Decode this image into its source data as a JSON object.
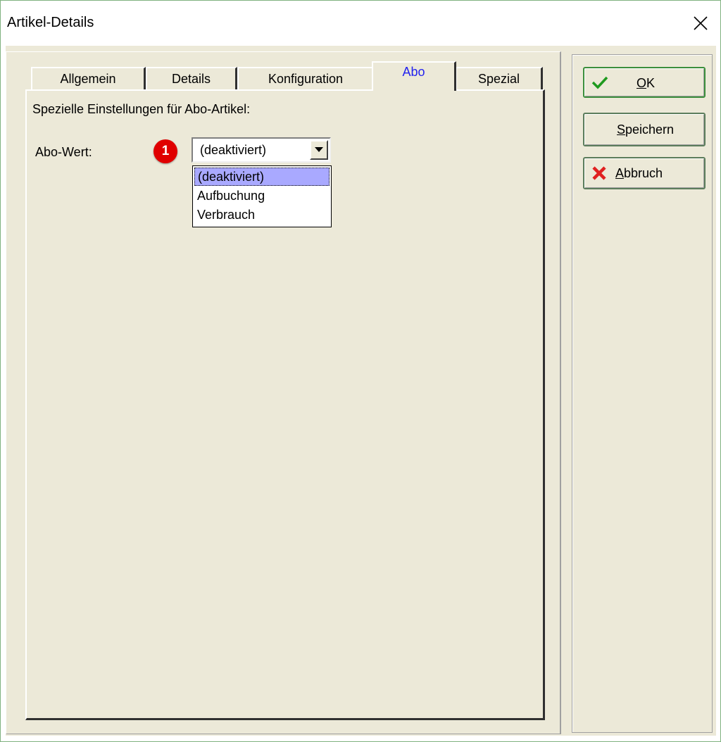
{
  "window": {
    "title": "Artikel-Details"
  },
  "tabs": [
    {
      "label": "Allgemein"
    },
    {
      "label": "Details"
    },
    {
      "label": "Konfiguration"
    },
    {
      "label": "Abo",
      "active": true
    },
    {
      "label": "Spezial"
    }
  ],
  "panel": {
    "heading": "Spezielle Einstellungen für Abo-Artikel:",
    "abo_label": "Abo-Wert:",
    "badge": "1",
    "combo_value": "(deaktiviert)",
    "options": [
      "(deaktiviert)",
      "Aufbuchung",
      "Verbrauch"
    ],
    "selected_option": "(deaktiviert)"
  },
  "buttons": {
    "ok_mnemonic": "O",
    "ok_rest": "K",
    "save_mnemonic": "S",
    "save_rest": "peichern",
    "cancel_mnemonic": "A",
    "cancel_rest": "bbruch"
  },
  "icons": {
    "close": "close-icon",
    "ok": "checkmark-icon",
    "cancel": "red-x-icon",
    "dropdown": "triangle-down-icon"
  },
  "colors": {
    "dialog_bg": "#ece9d8",
    "active_tab_text": "#2222ee",
    "selection": "#a9a9ff",
    "badge": "#e00000",
    "ok_check": "#1f9a1f",
    "cancel_x": "#e02020"
  }
}
